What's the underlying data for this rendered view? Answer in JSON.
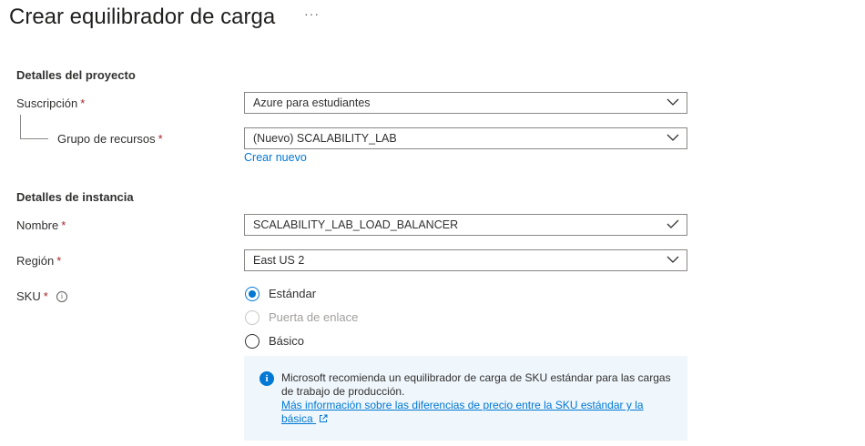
{
  "page": {
    "title": "Crear equilibrador de carga",
    "more_actions": "···"
  },
  "project_details": {
    "heading": "Detalles del proyecto",
    "subscription": {
      "label": "Suscripción",
      "required_mark": "*",
      "value": "Azure para estudiantes"
    },
    "resource_group": {
      "label": "Grupo de recursos",
      "required_mark": "*",
      "value": "(Nuevo) SCALABILITY_LAB",
      "create_new_link": "Crear nuevo"
    }
  },
  "instance_details": {
    "heading": "Detalles de instancia",
    "name": {
      "label": "Nombre",
      "required_mark": "*",
      "value": "SCALABILITY_LAB_LOAD_BALANCER"
    },
    "region": {
      "label": "Región",
      "required_mark": "*",
      "value": "East US 2"
    },
    "sku": {
      "label": "SKU",
      "required_mark": "*",
      "options": [
        {
          "label": "Estándar",
          "selected": true,
          "disabled": false
        },
        {
          "label": "Puerta de enlace",
          "selected": false,
          "disabled": true
        },
        {
          "label": "Básico",
          "selected": false,
          "disabled": false
        }
      ]
    }
  },
  "info_banner": {
    "text": "Microsoft recomienda un equilibrador de carga de SKU estándar para las cargas de trabajo de producción.",
    "link_text": "Más información sobre las diferencias de precio entre la SKU estándar y la básica"
  },
  "colors": {
    "accent": "#0078d4",
    "required": "#a4262c",
    "info_background": "#eff6fc"
  }
}
